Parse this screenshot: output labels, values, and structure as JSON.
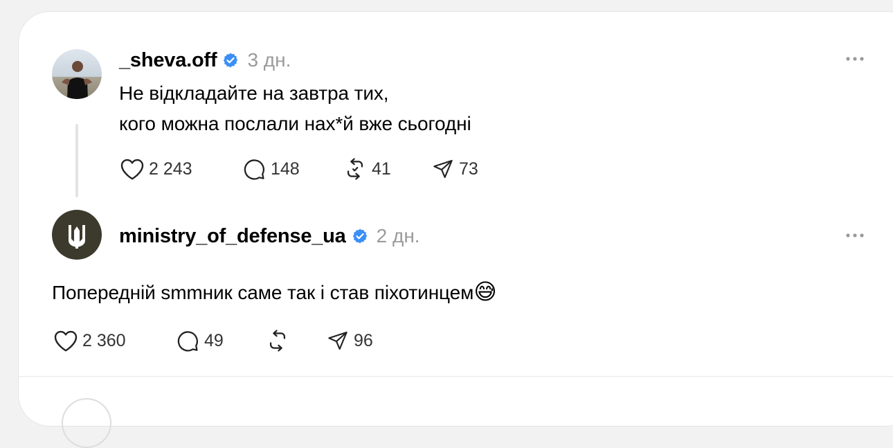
{
  "posts": [
    {
      "username": "_sheva.off",
      "time": "3 дн.",
      "verified": true,
      "text_lines": [
        "Не відкладайте на завтра тих,",
        "кого можна послали нах*й вже сьогодні"
      ],
      "likes": "2 243",
      "replies": "148",
      "reposts": "41",
      "shares": "73"
    },
    {
      "username": "ministry_of_defense_ua",
      "time": "2 дн.",
      "verified": true,
      "text": "Попередній smmник саме так і став піхотинцем",
      "emoji": "😅",
      "likes": "2 360",
      "replies": "49",
      "reposts": "",
      "shares": "96"
    }
  ],
  "icons": {
    "verified": "verified-badge-icon",
    "more": "more-horizontal-icon",
    "like": "heart-icon",
    "reply": "comment-icon",
    "repost": "repost-icon",
    "share": "send-icon"
  },
  "colors": {
    "verified": "#3b8ff6",
    "mod_avatar_bg": "#3c3a2c",
    "mod_trident": "#ffffff"
  }
}
